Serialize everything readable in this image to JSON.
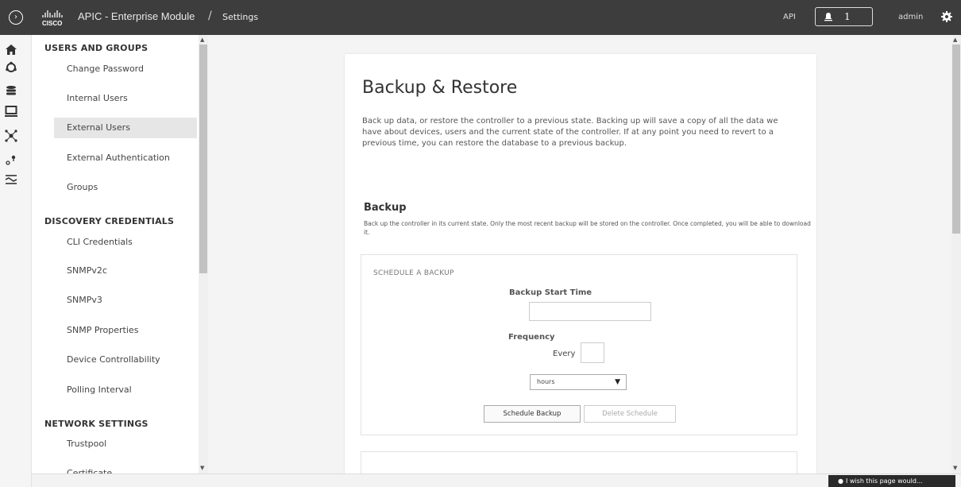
{
  "header": {
    "brand": "CISCO",
    "app_title": "APIC - Enterprise Module",
    "separator": "/",
    "breadcrumb": "Settings",
    "api_label": "API",
    "notification_count": "1",
    "user": "admin"
  },
  "rail": {
    "icons": [
      "home-icon",
      "discovery-icon",
      "database-icon",
      "monitor-icon",
      "topology-icon",
      "location-icon",
      "policy-icon"
    ]
  },
  "nav": {
    "sections": [
      {
        "title": "USERS AND GROUPS",
        "items": [
          "Change Password",
          "Internal Users",
          "External Users",
          "External Authentication",
          "Groups"
        ]
      },
      {
        "title": "DISCOVERY CREDENTIALS",
        "items": [
          "CLI Credentials",
          "SNMPv2c",
          "SNMPv3",
          "SNMP Properties",
          "Device Controllability",
          "Polling Interval"
        ]
      },
      {
        "title": "NETWORK SETTINGS",
        "items": [
          "Trustpool",
          "Certificate"
        ]
      }
    ],
    "active_item": "External Users"
  },
  "page": {
    "title": "Backup & Restore",
    "description": "Back up data, or restore the controller to a previous state. Backing up will save a copy of all the data we have about devices, users and the current state of the controller. If at any point you need to revert to a previous time, you can restore the database to a previous backup.",
    "backup": {
      "title": "Backup",
      "description": "Back up the controller in its current state. Only the most recent backup will be stored on the controller. Once completed, you will be able to download it."
    },
    "schedule": {
      "title": "SCHEDULE A BACKUP",
      "start_time_label": "Backup Start Time",
      "start_time_value": "",
      "frequency_label": "Frequency",
      "every_label": "Every",
      "every_value": "",
      "unit_selected": "hours",
      "schedule_button": "Schedule Backup",
      "delete_button": "Delete Schedule"
    }
  },
  "footer": {
    "feedback": "I wish this page would..."
  }
}
